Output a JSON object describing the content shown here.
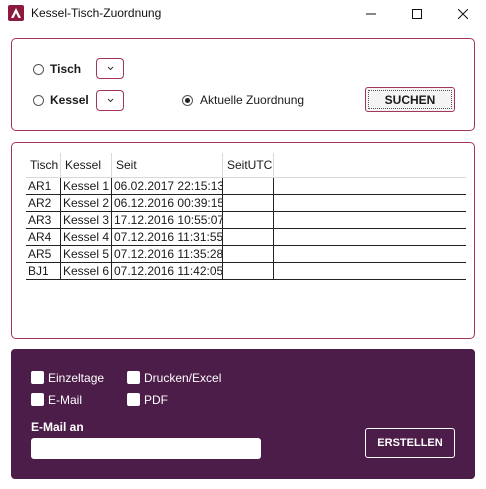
{
  "window": {
    "title": "Kessel-Tisch-Zuordnung",
    "icon": "app-logo-icon",
    "controls": [
      "minimize-icon",
      "maximize-icon",
      "close-icon"
    ]
  },
  "search": {
    "tisch_label": "Tisch",
    "tisch_selected": false,
    "kessel_label": "Kessel",
    "kessel_selected": false,
    "aktuell_label": "Aktuelle Zuordnung",
    "aktuell_selected": true,
    "tisch_combo_value": "",
    "kessel_combo_value": "",
    "button_label": "SUCHEN"
  },
  "grid": {
    "columns": [
      "Tisch",
      "Kessel",
      "Seit",
      "SeitUTC"
    ],
    "rows": [
      [
        "AR1",
        "Kessel 1",
        "06.02.2017 22:15:13",
        ""
      ],
      [
        "AR2",
        "Kessel 2",
        "06.12.2016 00:39:15",
        ""
      ],
      [
        "AR3",
        "Kessel 3",
        "17.12.2016 10:55:07",
        ""
      ],
      [
        "AR4",
        "Kessel 4",
        "07.12.2016 11:31:55",
        ""
      ],
      [
        "AR5",
        "Kessel 5",
        "07.12.2016 11:35:28",
        ""
      ],
      [
        "BJ1",
        "Kessel 6",
        "07.12.2016 11:42:05",
        ""
      ]
    ]
  },
  "export": {
    "einzeltage_label": "Einzeltage",
    "email_label": "E-Mail",
    "drucken_label": "Drucken/Excel",
    "pdf_label": "PDF",
    "email_title": "E-Mail an",
    "email_value": "",
    "email_placeholder": "",
    "button_label": "ERSTELLEN"
  },
  "colors": {
    "accent": "#a3345a",
    "footer_bg": "#4d1d4a",
    "app_icon_bg": "#8b1a3c"
  }
}
